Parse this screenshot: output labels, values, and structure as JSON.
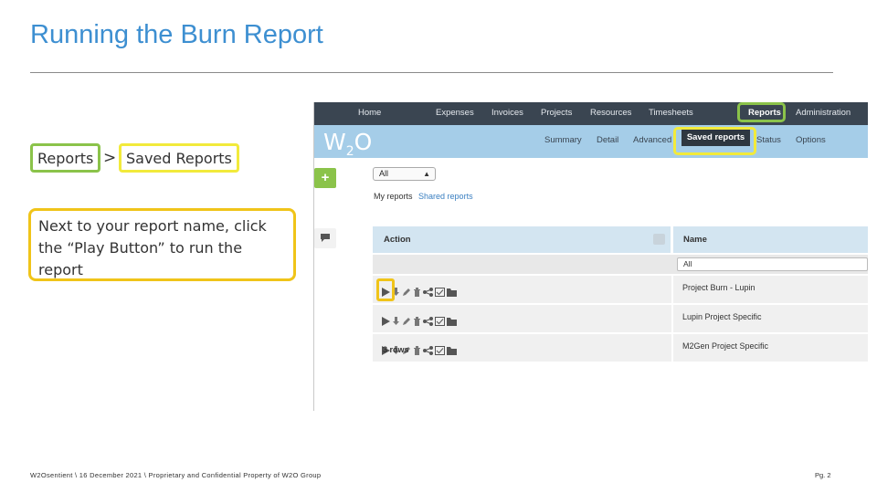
{
  "slide": {
    "title": "Running the Burn Report",
    "breadcrumb": {
      "reports": "Reports",
      "separator": ">",
      "saved": "Saved Reports"
    },
    "note": "Next to your report name, click the “Play Button” to run the report",
    "footer_left": "W2Osentient \\ 16 December 2021 \\ Proprietary and Confidential Property of W2O Group",
    "footer_right": "Pg. 2"
  },
  "app": {
    "top_nav": [
      "Home",
      "Expenses",
      "Invoices",
      "Projects",
      "Resources",
      "Timesheets",
      "Reports",
      "Administration"
    ],
    "logo": {
      "main": "W",
      "sub": "2",
      "tail": "O"
    },
    "sub_nav": [
      "Summary",
      "Detail",
      "Advanced",
      "Saved reports",
      "Status",
      "Options"
    ],
    "filter_select": "All",
    "tabs": {
      "my": "My reports",
      "shared": "Shared reports"
    },
    "table": {
      "headers": {
        "action": "Action",
        "name": "Name"
      },
      "name_filter": "All",
      "rows": [
        {
          "name": "Project Burn - Lupin"
        },
        {
          "name": "Lupin Project Specific"
        },
        {
          "name": "M2Gen Project Specific"
        }
      ],
      "count": "3 rows"
    },
    "colors": {
      "topbar": "#3a4551",
      "brandbar": "#a5cde8",
      "highlight_green": "#8bc34a",
      "highlight_yellow": "#f2ea3b",
      "highlight_orange": "#f0c419"
    },
    "row_icons": [
      "play-icon",
      "download-icon",
      "edit-icon",
      "delete-icon",
      "share-icon",
      "schedule-icon",
      "folder-icon"
    ]
  }
}
